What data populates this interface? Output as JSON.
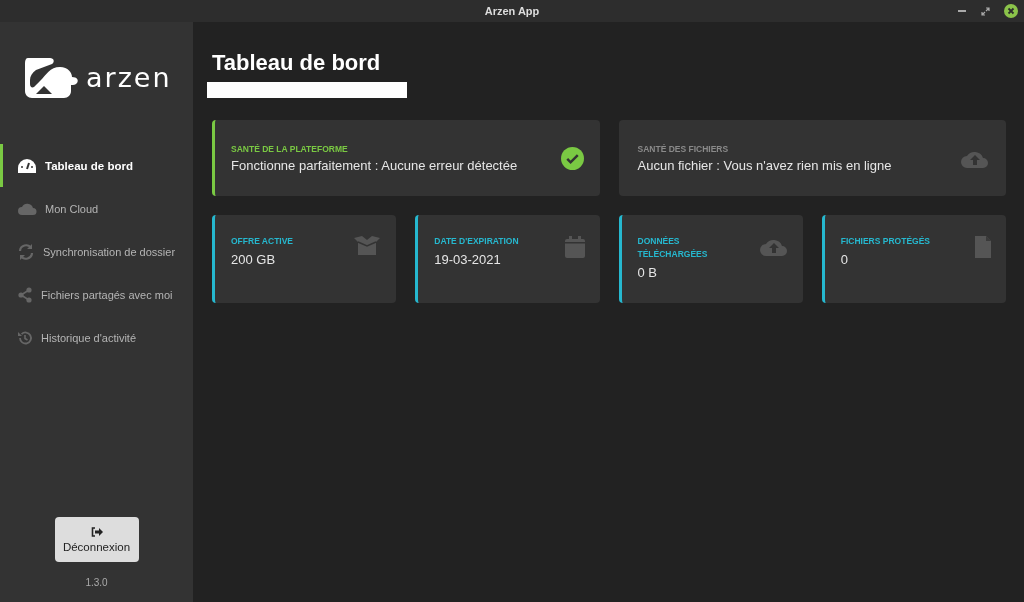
{
  "window": {
    "title": "Arzen App"
  },
  "sidebar": {
    "logo_text": "arzen",
    "items": [
      {
        "label": "Tableau de bord",
        "kind": "gauge",
        "selected": true
      },
      {
        "label": "Mon Cloud",
        "kind": "cloud",
        "selected": false
      },
      {
        "label": "Synchronisation de dossier",
        "kind": "sync",
        "selected": false
      },
      {
        "label": "Fichiers partagés avec moi",
        "kind": "share",
        "selected": false
      },
      {
        "label": "Historique d'activité",
        "kind": "history",
        "selected": false
      }
    ],
    "logout_button": "Déconnexion",
    "version": "1.3.0"
  },
  "page": {
    "title": "Tableau de bord"
  },
  "health_cards": [
    {
      "label": "SANTÉ DE LA PLATEFORME",
      "text": "Fonctionne parfaitement : Aucune erreur détectée",
      "kind": "ok"
    },
    {
      "label": "SANTÉ DES FICHIERS",
      "text": "Aucun fichier : Vous n'avez rien mis en ligne",
      "kind": "empty"
    }
  ],
  "stat_cards": [
    {
      "label": "OFFRE ACTIVE",
      "value": "200 GB",
      "kind": "offer"
    },
    {
      "label": "DATE D'EXPIRATION",
      "value": "19-03-2021",
      "kind": "date"
    },
    {
      "label": "DONNÉES TÉLÉCHARGÉES",
      "value": "0 B",
      "kind": "upload"
    },
    {
      "label": "FICHIERS PROTÉGÉS",
      "value": "0",
      "kind": "files"
    }
  ]
}
